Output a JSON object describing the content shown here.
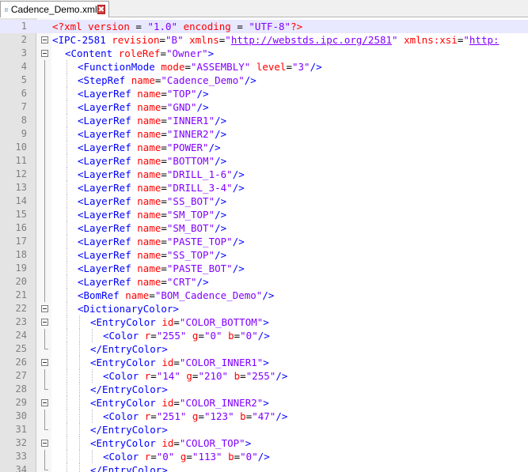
{
  "tab": {
    "filename": "Cadence_Demo.xml",
    "close_glyph": "✖"
  },
  "colors": {
    "tag": "#0000ff",
    "attr": "#ff0000",
    "value": "#8000ff",
    "current_line": "#e8e8ff"
  },
  "lines": [
    {
      "n": "1",
      "depth": 0,
      "fold": "none",
      "current": true,
      "tokens": [
        {
          "t": "pi",
          "v": "<?"
        },
        {
          "t": "ptxt",
          "v": "xml"
        },
        {
          "t": "op",
          "v": " "
        },
        {
          "t": "attr",
          "v": "version"
        },
        {
          "t": "op",
          "v": " = "
        },
        {
          "t": "val",
          "v": "\"1.0\""
        },
        {
          "t": "op",
          "v": " "
        },
        {
          "t": "attr",
          "v": "encoding"
        },
        {
          "t": "op",
          "v": " = "
        },
        {
          "t": "val",
          "v": "\"UTF-8\""
        },
        {
          "t": "pi",
          "v": "?>"
        }
      ]
    },
    {
      "n": "2",
      "depth": 0,
      "fold": "box",
      "tokens": [
        {
          "t": "tag",
          "v": "<IPC-2581"
        },
        {
          "t": "op",
          "v": " "
        },
        {
          "t": "attr",
          "v": "revision"
        },
        {
          "t": "op",
          "v": "="
        },
        {
          "t": "val",
          "v": "\"B\""
        },
        {
          "t": "op",
          "v": " "
        },
        {
          "t": "attr",
          "v": "xmlns"
        },
        {
          "t": "op",
          "v": "="
        },
        {
          "t": "val",
          "v": "\""
        },
        {
          "t": "link",
          "v": "http://webstds.ipc.org/2581"
        },
        {
          "t": "val",
          "v": "\""
        },
        {
          "t": "op",
          "v": " "
        },
        {
          "t": "attr",
          "v": "xmlns:xsi"
        },
        {
          "t": "op",
          "v": "="
        },
        {
          "t": "val",
          "v": "\""
        },
        {
          "t": "link",
          "v": "http:"
        }
      ]
    },
    {
      "n": "3",
      "depth": 1,
      "fold": "box",
      "tokens": [
        {
          "t": "tag",
          "v": "<Content"
        },
        {
          "t": "op",
          "v": " "
        },
        {
          "t": "attr",
          "v": "roleRef"
        },
        {
          "t": "op",
          "v": "="
        },
        {
          "t": "val",
          "v": "\"Owner\""
        },
        {
          "t": "tag",
          "v": ">"
        }
      ]
    },
    {
      "n": "4",
      "depth": 2,
      "fold": "bar",
      "tokens": [
        {
          "t": "tag",
          "v": "<FunctionMode"
        },
        {
          "t": "op",
          "v": " "
        },
        {
          "t": "attr",
          "v": "mode"
        },
        {
          "t": "op",
          "v": "="
        },
        {
          "t": "val",
          "v": "\"ASSEMBLY\""
        },
        {
          "t": "op",
          "v": " "
        },
        {
          "t": "attr",
          "v": "level"
        },
        {
          "t": "op",
          "v": "="
        },
        {
          "t": "val",
          "v": "\"3\""
        },
        {
          "t": "tag",
          "v": "/>"
        }
      ]
    },
    {
      "n": "5",
      "depth": 2,
      "fold": "bar",
      "tokens": [
        {
          "t": "tag",
          "v": "<StepRef"
        },
        {
          "t": "op",
          "v": " "
        },
        {
          "t": "attr",
          "v": "name"
        },
        {
          "t": "op",
          "v": "="
        },
        {
          "t": "val",
          "v": "\"Cadence_Demo\""
        },
        {
          "t": "tag",
          "v": "/>"
        }
      ]
    },
    {
      "n": "6",
      "depth": 2,
      "fold": "bar",
      "tokens": [
        {
          "t": "tag",
          "v": "<LayerRef"
        },
        {
          "t": "op",
          "v": " "
        },
        {
          "t": "attr",
          "v": "name"
        },
        {
          "t": "op",
          "v": "="
        },
        {
          "t": "val",
          "v": "\"TOP\""
        },
        {
          "t": "tag",
          "v": "/>"
        }
      ]
    },
    {
      "n": "7",
      "depth": 2,
      "fold": "bar",
      "tokens": [
        {
          "t": "tag",
          "v": "<LayerRef"
        },
        {
          "t": "op",
          "v": " "
        },
        {
          "t": "attr",
          "v": "name"
        },
        {
          "t": "op",
          "v": "="
        },
        {
          "t": "val",
          "v": "\"GND\""
        },
        {
          "t": "tag",
          "v": "/>"
        }
      ]
    },
    {
      "n": "8",
      "depth": 2,
      "fold": "bar",
      "tokens": [
        {
          "t": "tag",
          "v": "<LayerRef"
        },
        {
          "t": "op",
          "v": " "
        },
        {
          "t": "attr",
          "v": "name"
        },
        {
          "t": "op",
          "v": "="
        },
        {
          "t": "val",
          "v": "\"INNER1\""
        },
        {
          "t": "tag",
          "v": "/>"
        }
      ]
    },
    {
      "n": "9",
      "depth": 2,
      "fold": "bar",
      "tokens": [
        {
          "t": "tag",
          "v": "<LayerRef"
        },
        {
          "t": "op",
          "v": " "
        },
        {
          "t": "attr",
          "v": "name"
        },
        {
          "t": "op",
          "v": "="
        },
        {
          "t": "val",
          "v": "\"INNER2\""
        },
        {
          "t": "tag",
          "v": "/>"
        }
      ]
    },
    {
      "n": "10",
      "depth": 2,
      "fold": "bar",
      "tokens": [
        {
          "t": "tag",
          "v": "<LayerRef"
        },
        {
          "t": "op",
          "v": " "
        },
        {
          "t": "attr",
          "v": "name"
        },
        {
          "t": "op",
          "v": "="
        },
        {
          "t": "val",
          "v": "\"POWER\""
        },
        {
          "t": "tag",
          "v": "/>"
        }
      ]
    },
    {
      "n": "11",
      "depth": 2,
      "fold": "bar",
      "tokens": [
        {
          "t": "tag",
          "v": "<LayerRef"
        },
        {
          "t": "op",
          "v": " "
        },
        {
          "t": "attr",
          "v": "name"
        },
        {
          "t": "op",
          "v": "="
        },
        {
          "t": "val",
          "v": "\"BOTTOM\""
        },
        {
          "t": "tag",
          "v": "/>"
        }
      ]
    },
    {
      "n": "12",
      "depth": 2,
      "fold": "bar",
      "tokens": [
        {
          "t": "tag",
          "v": "<LayerRef"
        },
        {
          "t": "op",
          "v": " "
        },
        {
          "t": "attr",
          "v": "name"
        },
        {
          "t": "op",
          "v": "="
        },
        {
          "t": "val",
          "v": "\"DRILL_1-6\""
        },
        {
          "t": "tag",
          "v": "/>"
        }
      ]
    },
    {
      "n": "13",
      "depth": 2,
      "fold": "bar",
      "tokens": [
        {
          "t": "tag",
          "v": "<LayerRef"
        },
        {
          "t": "op",
          "v": " "
        },
        {
          "t": "attr",
          "v": "name"
        },
        {
          "t": "op",
          "v": "="
        },
        {
          "t": "val",
          "v": "\"DRILL_3-4\""
        },
        {
          "t": "tag",
          "v": "/>"
        }
      ]
    },
    {
      "n": "14",
      "depth": 2,
      "fold": "bar",
      "tokens": [
        {
          "t": "tag",
          "v": "<LayerRef"
        },
        {
          "t": "op",
          "v": " "
        },
        {
          "t": "attr",
          "v": "name"
        },
        {
          "t": "op",
          "v": "="
        },
        {
          "t": "val",
          "v": "\"SS_BOT\""
        },
        {
          "t": "tag",
          "v": "/>"
        }
      ]
    },
    {
      "n": "15",
      "depth": 2,
      "fold": "bar",
      "tokens": [
        {
          "t": "tag",
          "v": "<LayerRef"
        },
        {
          "t": "op",
          "v": " "
        },
        {
          "t": "attr",
          "v": "name"
        },
        {
          "t": "op",
          "v": "="
        },
        {
          "t": "val",
          "v": "\"SM_TOP\""
        },
        {
          "t": "tag",
          "v": "/>"
        }
      ]
    },
    {
      "n": "16",
      "depth": 2,
      "fold": "bar",
      "tokens": [
        {
          "t": "tag",
          "v": "<LayerRef"
        },
        {
          "t": "op",
          "v": " "
        },
        {
          "t": "attr",
          "v": "name"
        },
        {
          "t": "op",
          "v": "="
        },
        {
          "t": "val",
          "v": "\"SM_BOT\""
        },
        {
          "t": "tag",
          "v": "/>"
        }
      ]
    },
    {
      "n": "17",
      "depth": 2,
      "fold": "bar",
      "tokens": [
        {
          "t": "tag",
          "v": "<LayerRef"
        },
        {
          "t": "op",
          "v": " "
        },
        {
          "t": "attr",
          "v": "name"
        },
        {
          "t": "op",
          "v": "="
        },
        {
          "t": "val",
          "v": "\"PASTE_TOP\""
        },
        {
          "t": "tag",
          "v": "/>"
        }
      ]
    },
    {
      "n": "18",
      "depth": 2,
      "fold": "bar",
      "tokens": [
        {
          "t": "tag",
          "v": "<LayerRef"
        },
        {
          "t": "op",
          "v": " "
        },
        {
          "t": "attr",
          "v": "name"
        },
        {
          "t": "op",
          "v": "="
        },
        {
          "t": "val",
          "v": "\"SS_TOP\""
        },
        {
          "t": "tag",
          "v": "/>"
        }
      ]
    },
    {
      "n": "19",
      "depth": 2,
      "fold": "bar",
      "tokens": [
        {
          "t": "tag",
          "v": "<LayerRef"
        },
        {
          "t": "op",
          "v": " "
        },
        {
          "t": "attr",
          "v": "name"
        },
        {
          "t": "op",
          "v": "="
        },
        {
          "t": "val",
          "v": "\"PASTE_BOT\""
        },
        {
          "t": "tag",
          "v": "/>"
        }
      ]
    },
    {
      "n": "20",
      "depth": 2,
      "fold": "bar",
      "tokens": [
        {
          "t": "tag",
          "v": "<LayerRef"
        },
        {
          "t": "op",
          "v": " "
        },
        {
          "t": "attr",
          "v": "name"
        },
        {
          "t": "op",
          "v": "="
        },
        {
          "t": "val",
          "v": "\"CRT\""
        },
        {
          "t": "tag",
          "v": "/>"
        }
      ]
    },
    {
      "n": "21",
      "depth": 2,
      "fold": "bar",
      "tokens": [
        {
          "t": "tag",
          "v": "<BomRef"
        },
        {
          "t": "op",
          "v": " "
        },
        {
          "t": "attr",
          "v": "name"
        },
        {
          "t": "op",
          "v": "="
        },
        {
          "t": "val",
          "v": "\"BOM_Cadence_Demo\""
        },
        {
          "t": "tag",
          "v": "/>"
        }
      ]
    },
    {
      "n": "22",
      "depth": 2,
      "fold": "box",
      "tokens": [
        {
          "t": "tag",
          "v": "<DictionaryColor>"
        }
      ]
    },
    {
      "n": "23",
      "depth": 3,
      "fold": "box",
      "tokens": [
        {
          "t": "tag",
          "v": "<EntryColor"
        },
        {
          "t": "op",
          "v": " "
        },
        {
          "t": "attr",
          "v": "id"
        },
        {
          "t": "op",
          "v": "="
        },
        {
          "t": "val",
          "v": "\"COLOR_BOTTOM\""
        },
        {
          "t": "tag",
          "v": ">"
        }
      ]
    },
    {
      "n": "24",
      "depth": 4,
      "fold": "bar",
      "tokens": [
        {
          "t": "tag",
          "v": "<Color"
        },
        {
          "t": "op",
          "v": " "
        },
        {
          "t": "attr",
          "v": "r"
        },
        {
          "t": "op",
          "v": "="
        },
        {
          "t": "val",
          "v": "\"255\""
        },
        {
          "t": "op",
          "v": " "
        },
        {
          "t": "attr",
          "v": "g"
        },
        {
          "t": "op",
          "v": "="
        },
        {
          "t": "val",
          "v": "\"0\""
        },
        {
          "t": "op",
          "v": " "
        },
        {
          "t": "attr",
          "v": "b"
        },
        {
          "t": "op",
          "v": "="
        },
        {
          "t": "val",
          "v": "\"0\""
        },
        {
          "t": "tag",
          "v": "/>"
        }
      ]
    },
    {
      "n": "25",
      "depth": 3,
      "fold": "end",
      "tokens": [
        {
          "t": "tag",
          "v": "</EntryColor>"
        }
      ]
    },
    {
      "n": "26",
      "depth": 3,
      "fold": "box",
      "tokens": [
        {
          "t": "tag",
          "v": "<EntryColor"
        },
        {
          "t": "op",
          "v": " "
        },
        {
          "t": "attr",
          "v": "id"
        },
        {
          "t": "op",
          "v": "="
        },
        {
          "t": "val",
          "v": "\"COLOR_INNER1\""
        },
        {
          "t": "tag",
          "v": ">"
        }
      ]
    },
    {
      "n": "27",
      "depth": 4,
      "fold": "bar",
      "tokens": [
        {
          "t": "tag",
          "v": "<Color"
        },
        {
          "t": "op",
          "v": " "
        },
        {
          "t": "attr",
          "v": "r"
        },
        {
          "t": "op",
          "v": "="
        },
        {
          "t": "val",
          "v": "\"14\""
        },
        {
          "t": "op",
          "v": " "
        },
        {
          "t": "attr",
          "v": "g"
        },
        {
          "t": "op",
          "v": "="
        },
        {
          "t": "val",
          "v": "\"210\""
        },
        {
          "t": "op",
          "v": " "
        },
        {
          "t": "attr",
          "v": "b"
        },
        {
          "t": "op",
          "v": "="
        },
        {
          "t": "val",
          "v": "\"255\""
        },
        {
          "t": "tag",
          "v": "/>"
        }
      ]
    },
    {
      "n": "28",
      "depth": 3,
      "fold": "end",
      "tokens": [
        {
          "t": "tag",
          "v": "</EntryColor>"
        }
      ]
    },
    {
      "n": "29",
      "depth": 3,
      "fold": "box",
      "tokens": [
        {
          "t": "tag",
          "v": "<EntryColor"
        },
        {
          "t": "op",
          "v": " "
        },
        {
          "t": "attr",
          "v": "id"
        },
        {
          "t": "op",
          "v": "="
        },
        {
          "t": "val",
          "v": "\"COLOR_INNER2\""
        },
        {
          "t": "tag",
          "v": ">"
        }
      ]
    },
    {
      "n": "30",
      "depth": 4,
      "fold": "bar",
      "tokens": [
        {
          "t": "tag",
          "v": "<Color"
        },
        {
          "t": "op",
          "v": " "
        },
        {
          "t": "attr",
          "v": "r"
        },
        {
          "t": "op",
          "v": "="
        },
        {
          "t": "val",
          "v": "\"251\""
        },
        {
          "t": "op",
          "v": " "
        },
        {
          "t": "attr",
          "v": "g"
        },
        {
          "t": "op",
          "v": "="
        },
        {
          "t": "val",
          "v": "\"123\""
        },
        {
          "t": "op",
          "v": " "
        },
        {
          "t": "attr",
          "v": "b"
        },
        {
          "t": "op",
          "v": "="
        },
        {
          "t": "val",
          "v": "\"47\""
        },
        {
          "t": "tag",
          "v": "/>"
        }
      ]
    },
    {
      "n": "31",
      "depth": 3,
      "fold": "end",
      "tokens": [
        {
          "t": "tag",
          "v": "</EntryColor>"
        }
      ]
    },
    {
      "n": "32",
      "depth": 3,
      "fold": "box",
      "tokens": [
        {
          "t": "tag",
          "v": "<EntryColor"
        },
        {
          "t": "op",
          "v": " "
        },
        {
          "t": "attr",
          "v": "id"
        },
        {
          "t": "op",
          "v": "="
        },
        {
          "t": "val",
          "v": "\"COLOR_TOP\""
        },
        {
          "t": "tag",
          "v": ">"
        }
      ]
    },
    {
      "n": "33",
      "depth": 4,
      "fold": "bar",
      "tokens": [
        {
          "t": "tag",
          "v": "<Color"
        },
        {
          "t": "op",
          "v": " "
        },
        {
          "t": "attr",
          "v": "r"
        },
        {
          "t": "op",
          "v": "="
        },
        {
          "t": "val",
          "v": "\"0\""
        },
        {
          "t": "op",
          "v": " "
        },
        {
          "t": "attr",
          "v": "g"
        },
        {
          "t": "op",
          "v": "="
        },
        {
          "t": "val",
          "v": "\"113\""
        },
        {
          "t": "op",
          "v": " "
        },
        {
          "t": "attr",
          "v": "b"
        },
        {
          "t": "op",
          "v": "="
        },
        {
          "t": "val",
          "v": "\"0\""
        },
        {
          "t": "tag",
          "v": "/>"
        }
      ]
    },
    {
      "n": "34",
      "depth": 3,
      "fold": "end",
      "tokens": [
        {
          "t": "tag",
          "v": "</EntryColor>"
        }
      ]
    }
  ]
}
